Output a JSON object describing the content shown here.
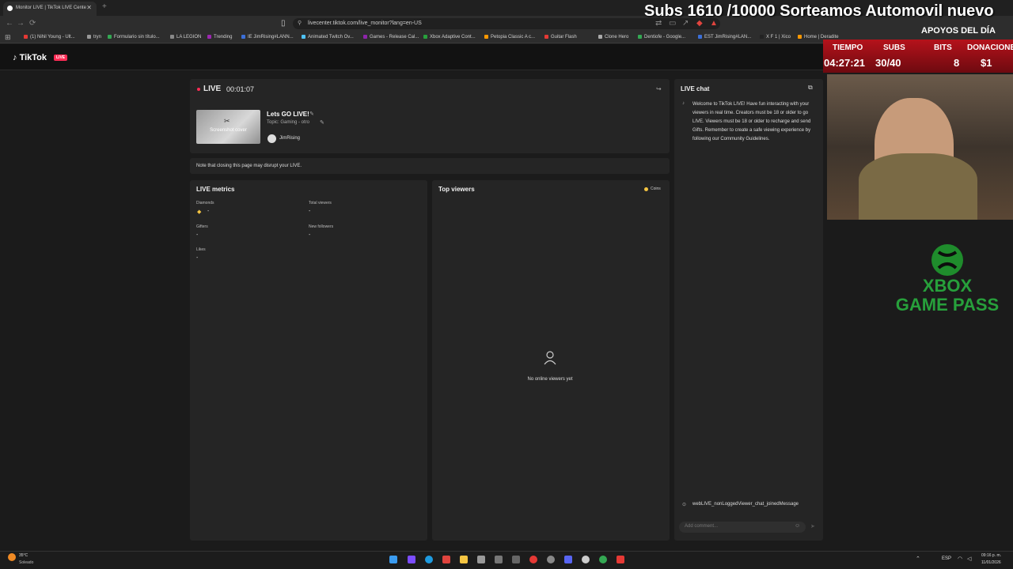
{
  "browser": {
    "tab_title": "Monitor LIVE | TikTok LIVE Cente",
    "url": "livecenter.tiktok.com/live_monitor?lang=en-US",
    "bookmarks": [
      "(1) Nihil Young - Ult...",
      "tryn",
      "Formulario sin título...",
      "LA LEGION",
      "Trending",
      "IE JimRising#LANN...",
      "Animated Twitch Ov...",
      "Games - Release Cal...",
      "Xbox Adaptive Cont...",
      "Petopia Classic A c...",
      "Guitar Flash",
      "Clone Hero",
      "Dentiofe - Google...",
      "EST JimRising#LAN...",
      "X F 1 | Xico",
      "Home | Deradite"
    ]
  },
  "header": {
    "logo": "TikTok",
    "badge": "LIVE"
  },
  "live": {
    "status": "LIVE",
    "timer": "00:01:07",
    "cover_label": "Screenshot cover",
    "title": "Lets GO LIVE!",
    "topic": "Topic: Gaming - otro",
    "host": "JimRising",
    "notice": "Note that closing this page may disrupt your LIVE."
  },
  "metrics": {
    "title": "LIVE metrics",
    "items": [
      {
        "label": "Diamonds",
        "value": "-"
      },
      {
        "label": "Total viewers",
        "value": "-"
      },
      {
        "label": "Gifters",
        "value": "-"
      },
      {
        "label": "New followers",
        "value": "-"
      },
      {
        "label": "Likes",
        "value": "-"
      }
    ]
  },
  "top_viewers": {
    "title": "Top viewers",
    "filter": "Coins",
    "empty": "No online viewers yet"
  },
  "chat": {
    "title": "LIVE chat",
    "welcome": "Welcome to TikTok LIVE! Have fun interacting with your viewers in real time. Creators must be 18 or older to go LIVE. Viewers must be 18 or older to recharge and send Gifts. Remember to create a safe viewing experience by following our Community Guidelines.",
    "system_msg": "webLIVE_nonLoggedViewer_chat_joinedMessage",
    "placeholder": "Add comment..."
  },
  "overlay": {
    "stream_title": "Subs 1610 /10000 Sorteamos Automovil nuevo",
    "apoyos": "APOYOS DEL DÍA",
    "stats": [
      {
        "label": "TIEMPO",
        "value": "04:27:21"
      },
      {
        "label": "SUBS",
        "value": "30/40"
      },
      {
        "label": "BITS",
        "value": "8"
      },
      {
        "label": "DONACIONES",
        "value": "$1"
      }
    ],
    "sponsor": "XBOX GAME PASS"
  },
  "taskbar": {
    "weather_temp": "35°C",
    "weather_desc": "Soleado",
    "lang": "ESP",
    "time": "09:16 p. m.",
    "date": "11/01/2026"
  },
  "colors": {
    "accent": "#fe2c55",
    "panel": "#252525",
    "overlay_red": "#b5121b",
    "xbox_green": "#27a03b"
  }
}
